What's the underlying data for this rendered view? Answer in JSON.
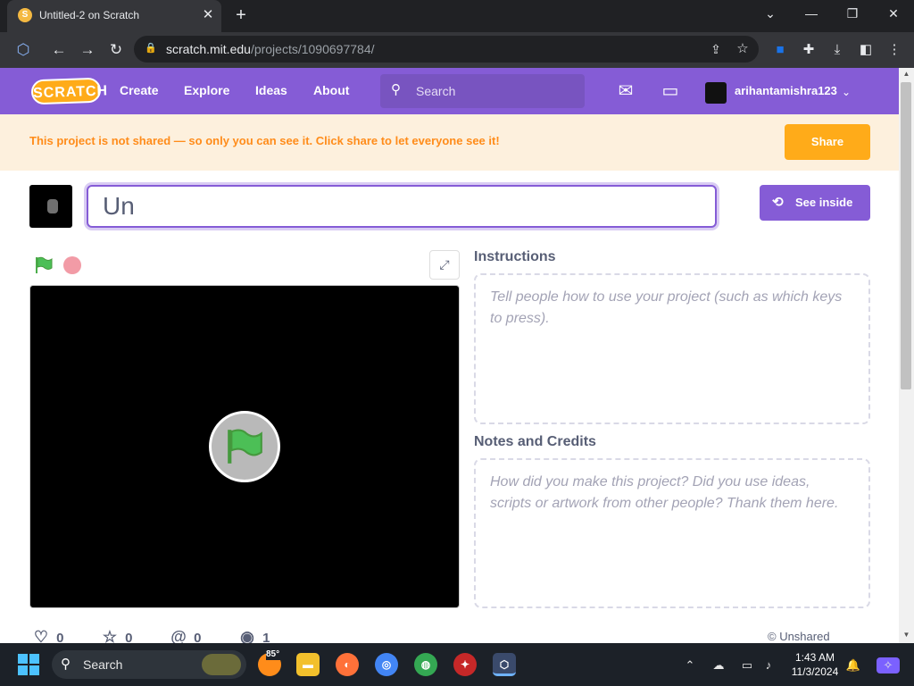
{
  "browser": {
    "tab_title": "Untitled-2 on Scratch",
    "tab_favicon": "S",
    "url_host": "scratch.mit.edu",
    "url_path": "/projects/1090697784/"
  },
  "nav": {
    "logo": "SCRATCH",
    "links": [
      "Create",
      "Explore",
      "Ideas",
      "About"
    ],
    "search_placeholder": "Search",
    "username": "arihantamishra123"
  },
  "banner": {
    "text": "This project is not shared — so only you can see it. Click share to let everyone see it!",
    "share_label": "Share"
  },
  "project": {
    "title_value": "Un",
    "see_inside_label": "See inside"
  },
  "instructions": {
    "heading": "Instructions",
    "placeholder": "Tell people how to use your project (such as which keys to press)."
  },
  "notes": {
    "heading": "Notes and Credits",
    "placeholder": "How did you make this project? Did you use ideas, scripts or artwork from other people? Thank them here."
  },
  "stats": {
    "loves": "0",
    "favorites": "0",
    "remixes": "0",
    "views": "1",
    "status": "© Unshared"
  },
  "taskbar": {
    "search_label": "Search",
    "weather_temp": "85°",
    "time": "1:43 AM",
    "date": "11/3/2024"
  },
  "colors": {
    "scratch_purple": "#855cd6",
    "share_orange": "#ffab19",
    "banner_text": "#ff8c1a",
    "banner_bg": "#fdf0dd"
  }
}
